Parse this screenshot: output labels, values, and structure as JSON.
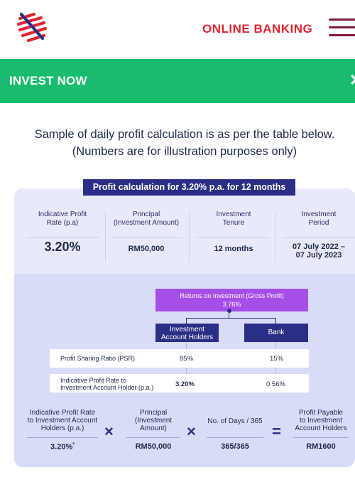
{
  "header": {
    "online_banking_label": "ONLINE BANKING"
  },
  "banner": {
    "label": "INVEST NOW",
    "close": "✕"
  },
  "intro": {
    "line1": "Sample of daily profit calculation is as per the table below.",
    "line2": "(Numbers are for illustration purposes only)"
  },
  "table_title": "Profit calculation for 3.20% p.a. for 12 months",
  "summary": [
    {
      "label1": "Indicative Profit",
      "label2": "Rate (p.a)",
      "value1": "3.20%",
      "value2": ""
    },
    {
      "label1": "Principal",
      "label2": "(Investment Amount)",
      "value1": "RM50,000",
      "value2": ""
    },
    {
      "label1": "Investment",
      "label2": "Tenure",
      "value1": "12 months",
      "value2": ""
    },
    {
      "label1": "Investment",
      "label2": "Period",
      "value1": "07 July 2022 –",
      "value2": "07 July 2023"
    }
  ],
  "returns": {
    "line1": "Returns on Investment (Gross Profit)",
    "line2": "3.76%"
  },
  "split": {
    "left1": "Investment",
    "left2": "Account Holders",
    "right": "Bank"
  },
  "rows": [
    {
      "label1": "Profit Sharing Ratio (PSR)",
      "label2": "",
      "left": "85%",
      "right": "15%"
    },
    {
      "label1": "Indicative Profit Rate to",
      "label2": "Investment Account Holder (p.a.)",
      "left": "3.20%",
      "right": "0.56%"
    }
  ],
  "formula": {
    "terms": [
      {
        "l1": "Indicative Profit Rate",
        "l2": "to Investment Account",
        "l3": "Holders (p.a.)",
        "value": "3.20%",
        "sup": "*"
      },
      {
        "l1": "Principal",
        "l2": "(Investment",
        "l3": "Amount)",
        "value": "RM50,000",
        "sup": ""
      },
      {
        "l1": "No. of Days / 365",
        "l2": "",
        "l3": "",
        "value": "365/365",
        "sup": ""
      },
      {
        "l1": "Profit Payable",
        "l2": "to Investment",
        "l3": "Account Holders",
        "value": "RM1600",
        "sup": ""
      }
    ],
    "ops": [
      "×",
      "×",
      "="
    ]
  },
  "colors": {
    "brand_red": "#e2242f",
    "banner_green": "#18bc6c",
    "navy": "#2b2e85",
    "purple": "#a64ee8"
  },
  "icons": {
    "logo": "bank-logo-icon",
    "menu": "hamburger-menu-icon",
    "close": "close-icon"
  }
}
